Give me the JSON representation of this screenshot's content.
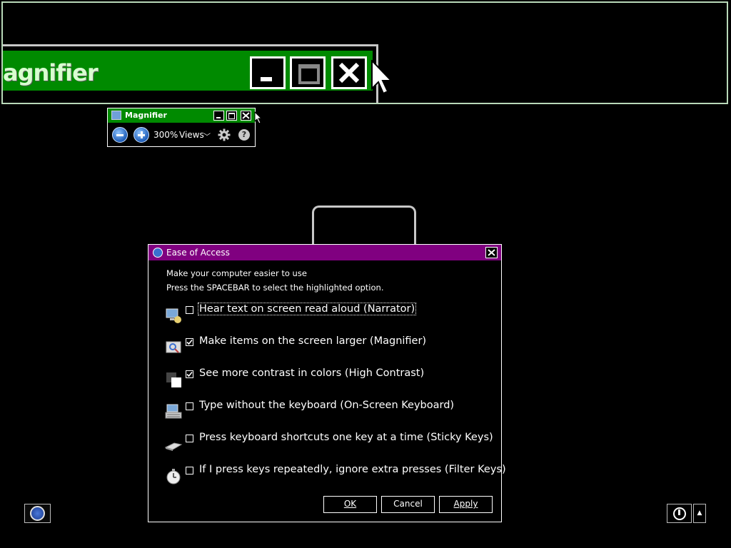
{
  "lens": {
    "title": "agnifier"
  },
  "magnifier": {
    "title": "Magnifier",
    "zoom_level": "300%",
    "views_label": "Views",
    "views_chevron": "﹀",
    "help_label": "?"
  },
  "dialog": {
    "title": "Ease of Access",
    "intro_line1": "Make your computer easier to use",
    "intro_line2": "Press the SPACEBAR to select the highlighted option.",
    "options": [
      {
        "label": "Hear text on screen read aloud (Narrator)",
        "checked": false,
        "icon": "narrator-icon"
      },
      {
        "label": "Make items on the screen larger (Magnifier)",
        "checked": true,
        "icon": "magnifier-icon"
      },
      {
        "label": "See more contrast in colors (High Contrast)",
        "checked": true,
        "icon": "high-contrast-icon"
      },
      {
        "label": "Type without the keyboard (On-Screen Keyboard)",
        "checked": false,
        "icon": "keyboard-icon"
      },
      {
        "label": "Press keyboard shortcuts one key at a time (Sticky Keys)",
        "checked": false,
        "icon": "sticky-keys-icon"
      },
      {
        "label": "If I press keys repeatedly, ignore extra presses (Filter Keys)",
        "checked": false,
        "icon": "stopwatch-icon"
      }
    ],
    "ok_label": "OK",
    "cancel_label": "Cancel",
    "apply_label": "Apply"
  },
  "power_arrow": "▲",
  "colors": {
    "magnifier_title": "#008a00",
    "dialog_title": "#800080",
    "background": "#000000"
  }
}
